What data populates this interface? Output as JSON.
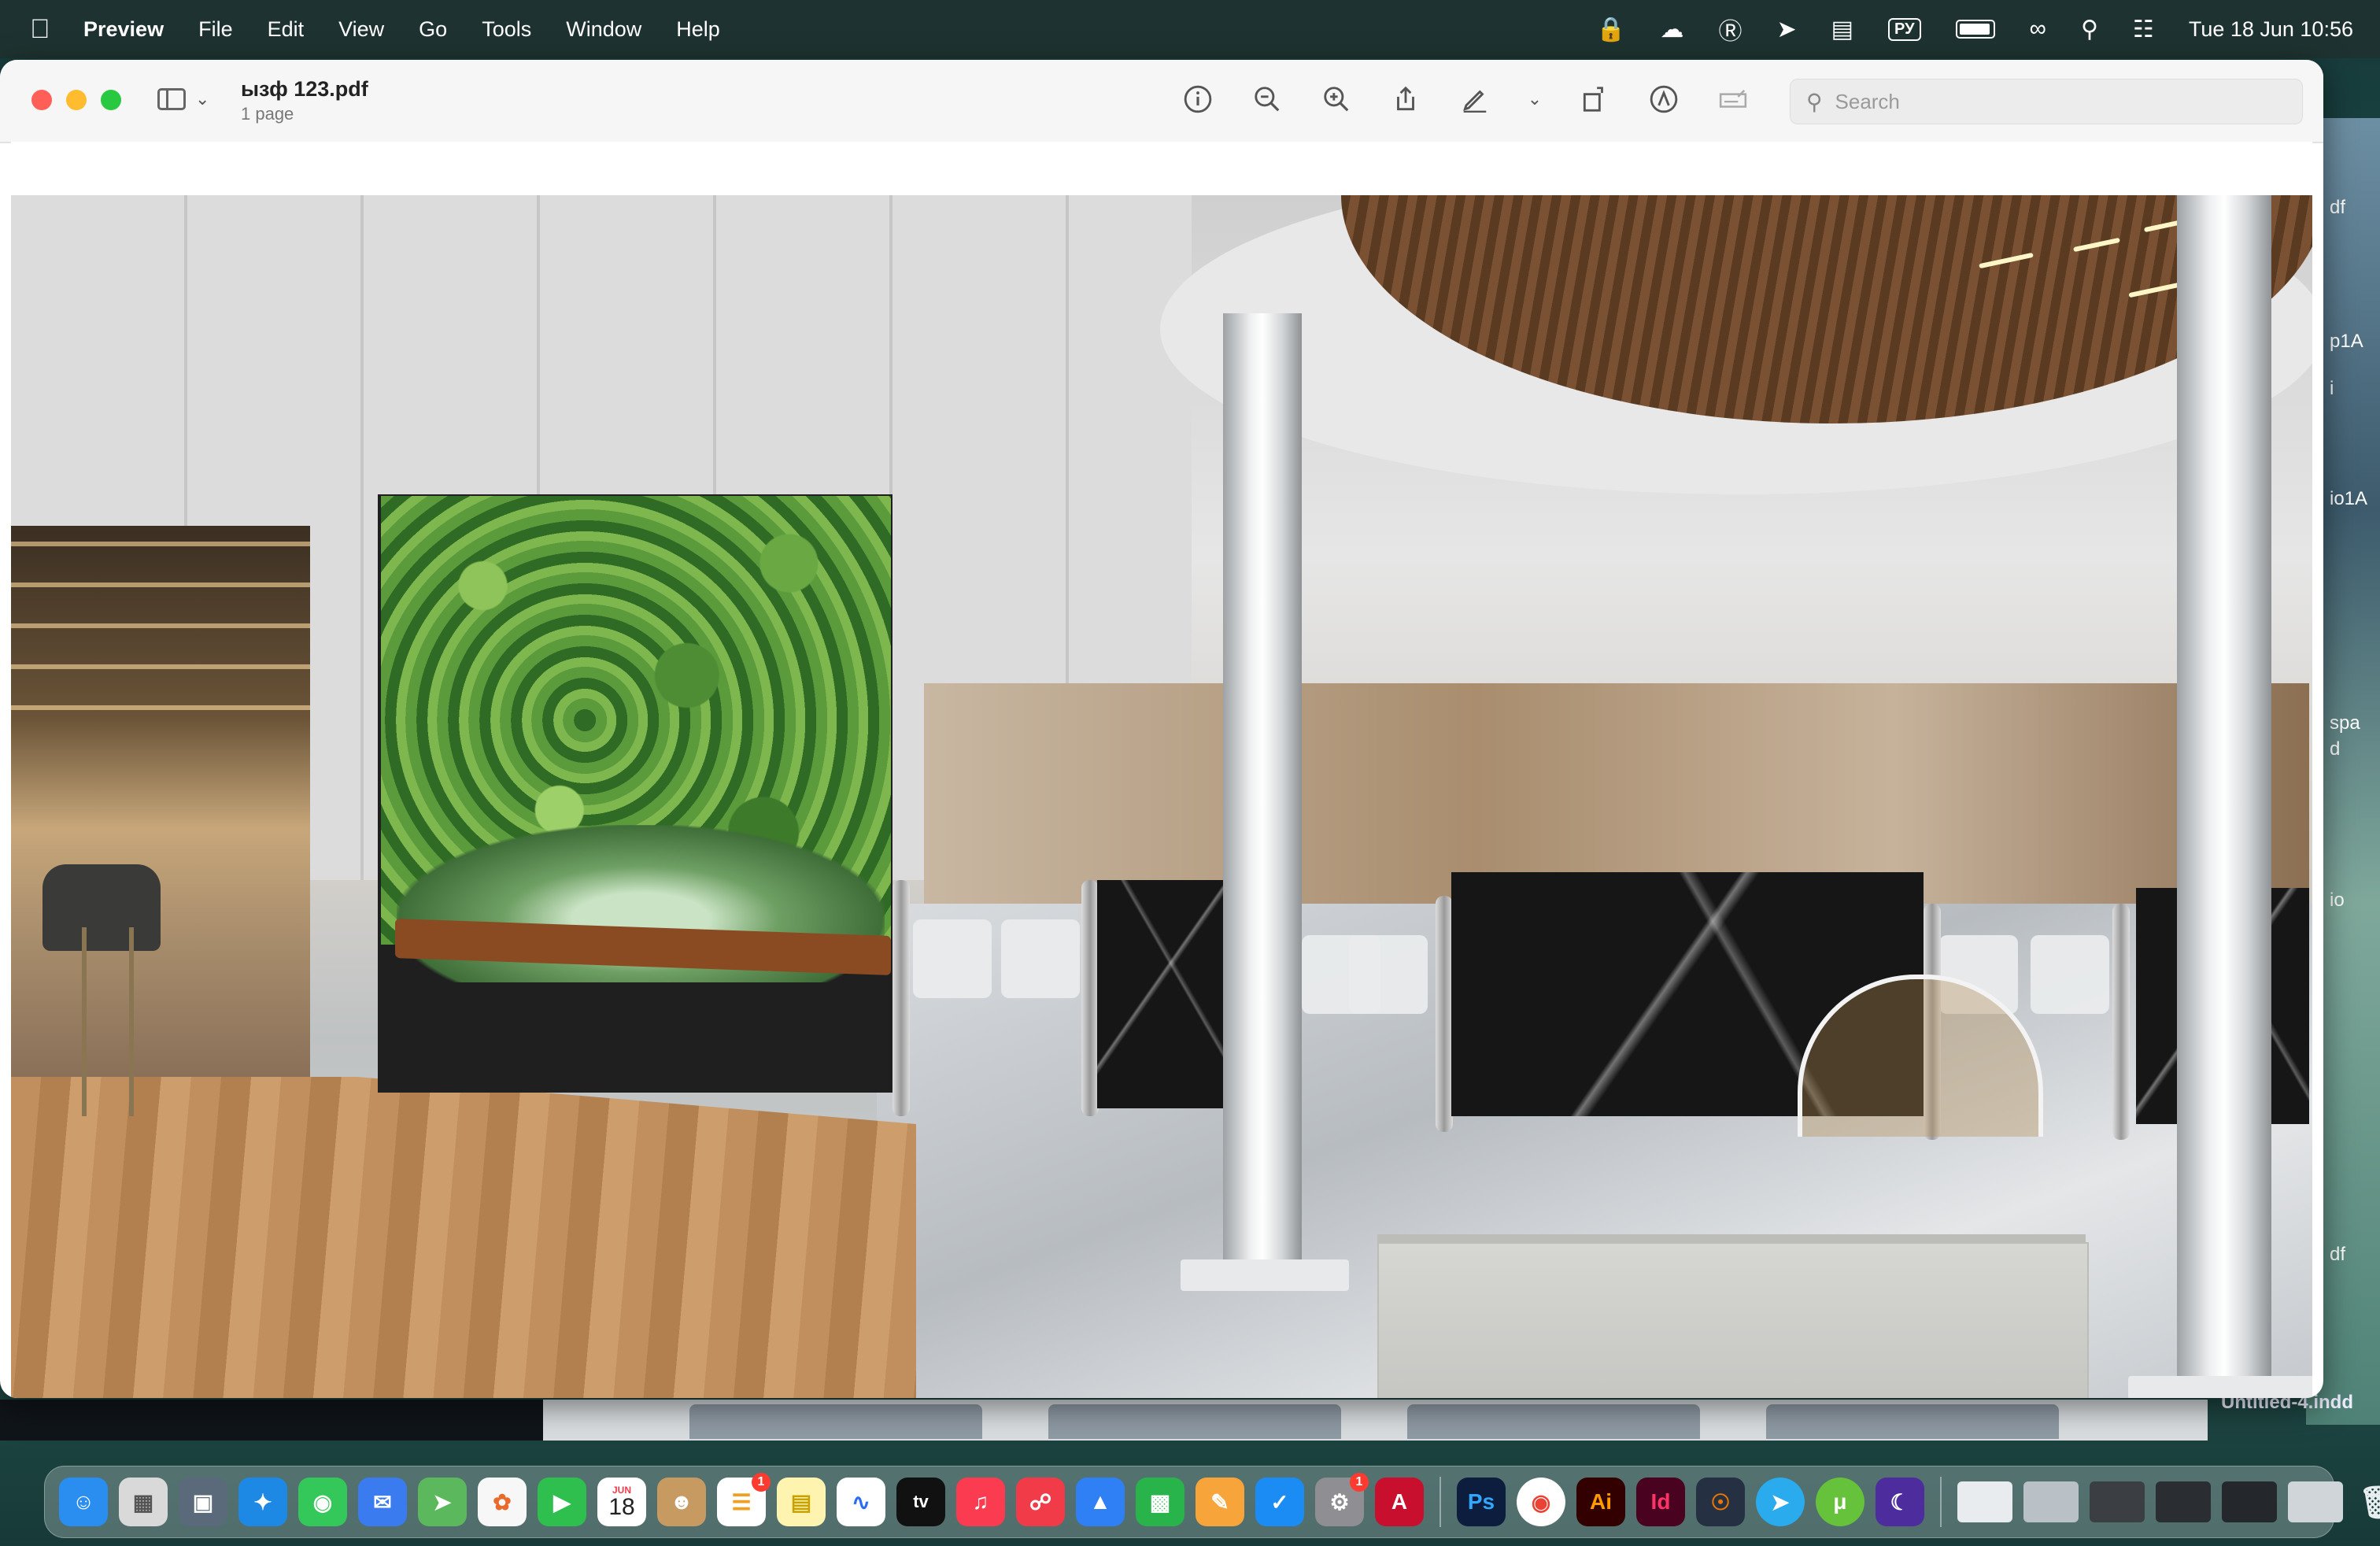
{
  "menubar": {
    "app_name": "Preview",
    "items": [
      "File",
      "Edit",
      "View",
      "Go",
      "Tools",
      "Window",
      "Help"
    ],
    "status": {
      "keyboard_layout": "РУ",
      "clock": "Tue 18 Jun  10:56"
    }
  },
  "window": {
    "title": "ызф 123.pdf",
    "subtitle": "1 page",
    "search_placeholder": "Search"
  },
  "background": {
    "side_labels": [
      "df",
      "p1A",
      "i",
      "io1A",
      "spa",
      "d",
      "io",
      "df"
    ],
    "indd_label": "Untitled-4.indd"
  },
  "dock": {
    "calendar_month": "JUN",
    "calendar_day": "18",
    "reminders_badge": "1",
    "settings_badge": "1",
    "apps": [
      {
        "id": "finder",
        "label": "",
        "color": "#2a8df0"
      },
      {
        "id": "launchpad",
        "label": "",
        "color": "#e6e6e6"
      },
      {
        "id": "screenshot",
        "label": "",
        "color": "#5a6a7a"
      },
      {
        "id": "safari",
        "label": "",
        "color": "#1e88e5"
      },
      {
        "id": "messages",
        "label": "",
        "color": "#34c759"
      },
      {
        "id": "mail",
        "label": "",
        "color": "#3a7bf0"
      },
      {
        "id": "maps",
        "label": "",
        "color": "#5cb85c"
      },
      {
        "id": "photos",
        "label": "",
        "color": "#f7f7f7"
      },
      {
        "id": "facetime",
        "label": "",
        "color": "#2fbf4f"
      },
      {
        "id": "calendar",
        "label": "",
        "color": "#ffffff"
      },
      {
        "id": "contacts",
        "label": "",
        "color": "#c79a62"
      },
      {
        "id": "reminders",
        "label": "",
        "color": "#ffffff"
      },
      {
        "id": "notes",
        "label": "",
        "color": "#fff3b0"
      },
      {
        "id": "freeform",
        "label": "",
        "color": "#ffffff"
      },
      {
        "id": "tv",
        "label": "tv",
        "color": "#111111"
      },
      {
        "id": "music",
        "label": "♫",
        "color": "#fa3b50"
      },
      {
        "id": "news",
        "label": "",
        "color": "#f23b48"
      },
      {
        "id": "keynote",
        "label": "",
        "color": "#2f7ff5"
      },
      {
        "id": "numbers",
        "label": "",
        "color": "#28b34b"
      },
      {
        "id": "pages",
        "label": "",
        "color": "#f7a43a"
      },
      {
        "id": "appstore",
        "label": "",
        "color": "#1c8cf5"
      },
      {
        "id": "settings",
        "label": "",
        "color": "#8e8e93"
      },
      {
        "id": "autocad",
        "label": "A",
        "color": "#c8102e"
      }
    ],
    "apps2": [
      {
        "id": "photoshop",
        "label": "Ps",
        "color": "#0c1d3d",
        "fg": "#31a8ff"
      },
      {
        "id": "chrome",
        "label": "",
        "color": "#ffffff",
        "fg": "#ea4335"
      },
      {
        "id": "illustrator",
        "label": "Ai",
        "color": "#330000",
        "fg": "#ff9a00"
      },
      {
        "id": "indesign",
        "label": "Id",
        "color": "#49021f",
        "fg": "#ff3366"
      },
      {
        "id": "blender",
        "label": "",
        "color": "#253042",
        "fg": "#ea7600"
      },
      {
        "id": "telegram",
        "label": "",
        "color": "#2aabee",
        "fg": "#ffffff"
      },
      {
        "id": "utorrent",
        "label": "",
        "color": "#66c23a",
        "fg": "#ffffff"
      },
      {
        "id": "other",
        "label": "",
        "color": "#4d2d9e",
        "fg": "#ffffff"
      }
    ]
  }
}
